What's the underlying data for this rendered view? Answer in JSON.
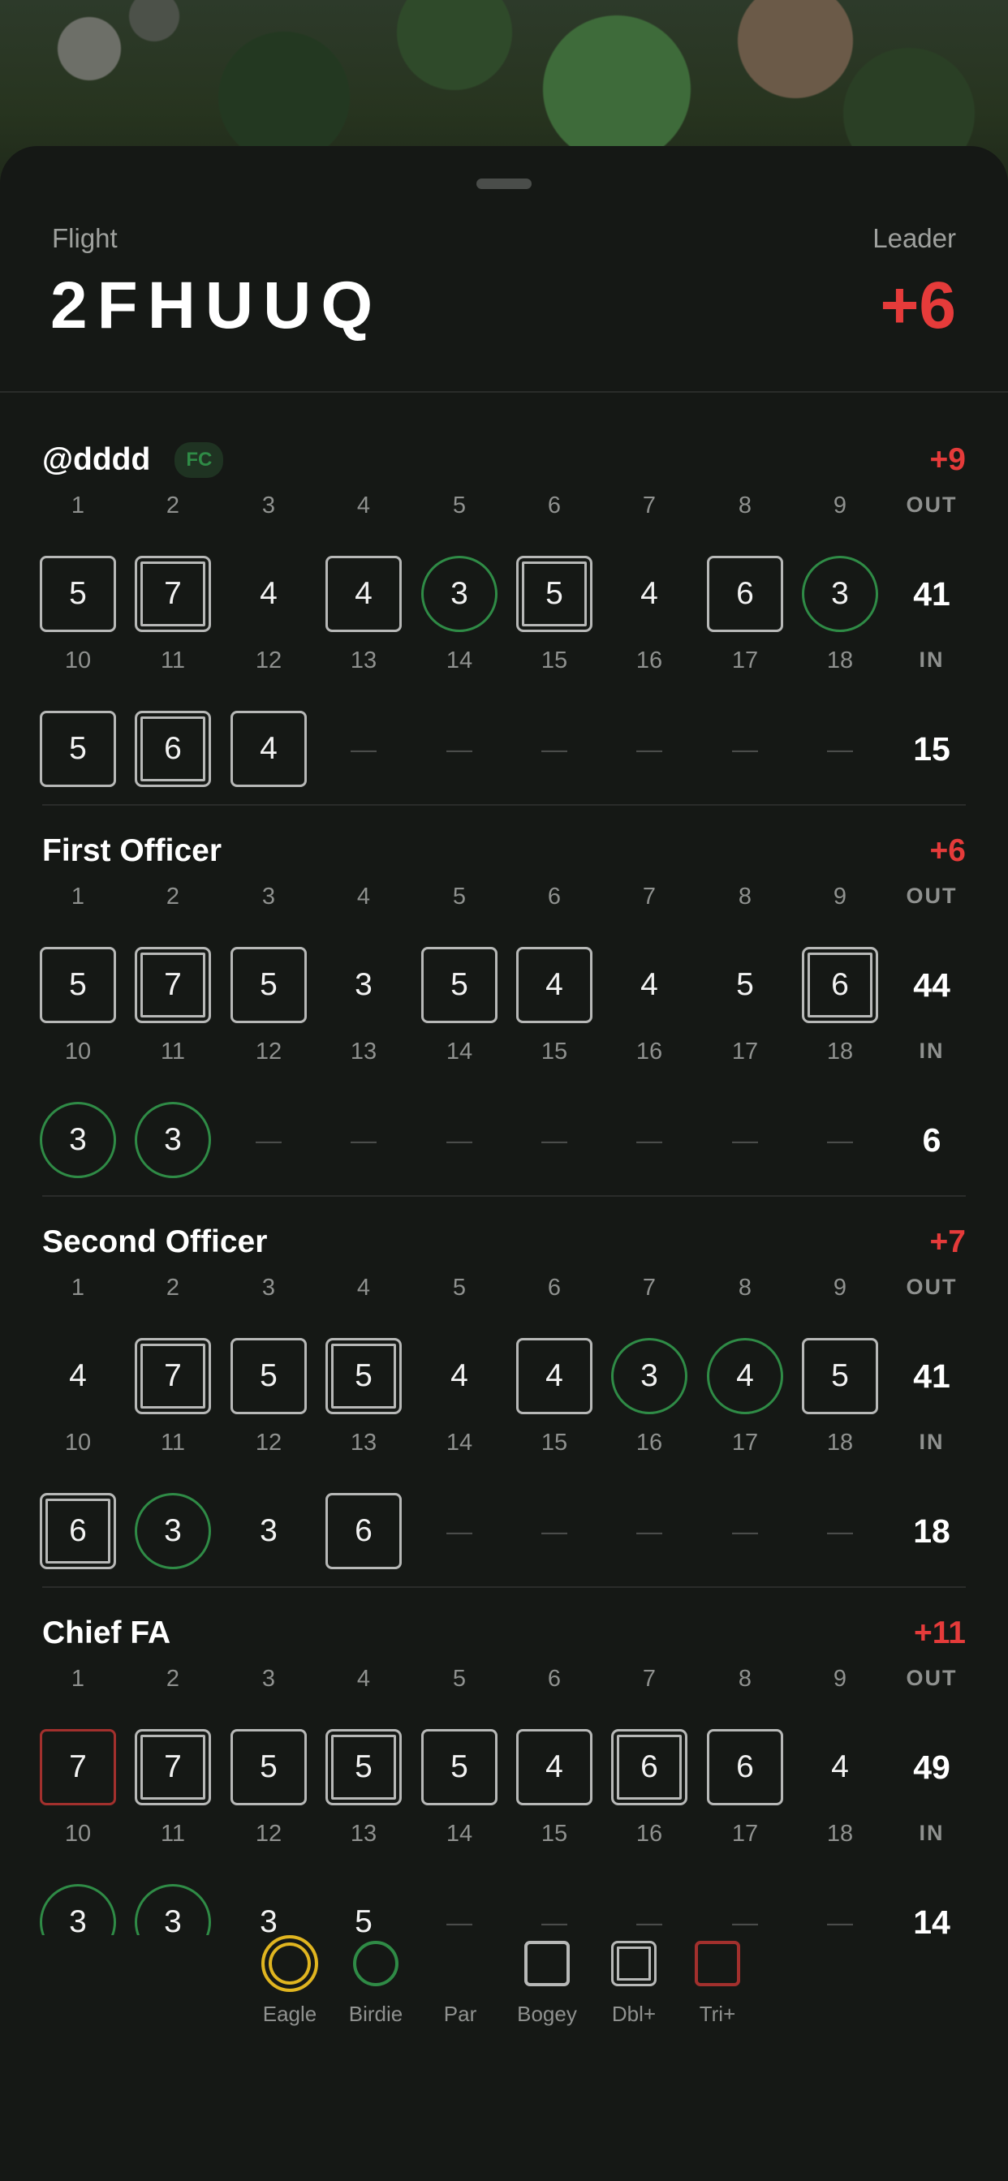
{
  "header": {
    "flight_label": "Flight",
    "flight_code": "2FHUUQ",
    "leader_label": "Leader",
    "leader_score": "+6"
  },
  "holes_front": [
    "1",
    "2",
    "3",
    "4",
    "5",
    "6",
    "7",
    "8",
    "9"
  ],
  "holes_back": [
    "10",
    "11",
    "12",
    "13",
    "14",
    "15",
    "16",
    "17",
    "18"
  ],
  "out_label": "OUT",
  "in_label": "IN",
  "dash": "—",
  "players": [
    {
      "name": "@dddd",
      "badge": "FC",
      "total": "+9",
      "front": [
        {
          "v": "5",
          "t": "bogey"
        },
        {
          "v": "7",
          "t": "dbl"
        },
        {
          "v": "4",
          "t": "par"
        },
        {
          "v": "4",
          "t": "bogey"
        },
        {
          "v": "3",
          "t": "birdie"
        },
        {
          "v": "5",
          "t": "dbl"
        },
        {
          "v": "4",
          "t": "par"
        },
        {
          "v": "6",
          "t": "bogey"
        },
        {
          "v": "3",
          "t": "birdie"
        }
      ],
      "out": "41",
      "back": [
        {
          "v": "5",
          "t": "bogey"
        },
        {
          "v": "6",
          "t": "dbl"
        },
        {
          "v": "4",
          "t": "bogey"
        },
        {
          "v": "—",
          "t": "dash"
        },
        {
          "v": "—",
          "t": "dash"
        },
        {
          "v": "—",
          "t": "dash"
        },
        {
          "v": "—",
          "t": "dash"
        },
        {
          "v": "—",
          "t": "dash"
        },
        {
          "v": "—",
          "t": "dash"
        }
      ],
      "in": "15"
    },
    {
      "name": "First Officer",
      "badge": "",
      "total": "+6",
      "front": [
        {
          "v": "5",
          "t": "bogey"
        },
        {
          "v": "7",
          "t": "dbl"
        },
        {
          "v": "5",
          "t": "bogey"
        },
        {
          "v": "3",
          "t": "par"
        },
        {
          "v": "5",
          "t": "bogey"
        },
        {
          "v": "4",
          "t": "bogey"
        },
        {
          "v": "4",
          "t": "par"
        },
        {
          "v": "5",
          "t": "par"
        },
        {
          "v": "6",
          "t": "dbl"
        }
      ],
      "out": "44",
      "back": [
        {
          "v": "3",
          "t": "birdie"
        },
        {
          "v": "3",
          "t": "birdie"
        },
        {
          "v": "—",
          "t": "dash"
        },
        {
          "v": "—",
          "t": "dash"
        },
        {
          "v": "—",
          "t": "dash"
        },
        {
          "v": "—",
          "t": "dash"
        },
        {
          "v": "—",
          "t": "dash"
        },
        {
          "v": "—",
          "t": "dash"
        },
        {
          "v": "—",
          "t": "dash"
        }
      ],
      "in": "6"
    },
    {
      "name": "Second Officer",
      "badge": "",
      "total": "+7",
      "front": [
        {
          "v": "4",
          "t": "par"
        },
        {
          "v": "7",
          "t": "dbl"
        },
        {
          "v": "5",
          "t": "bogey"
        },
        {
          "v": "5",
          "t": "dbl"
        },
        {
          "v": "4",
          "t": "par"
        },
        {
          "v": "4",
          "t": "bogey"
        },
        {
          "v": "3",
          "t": "birdie"
        },
        {
          "v": "4",
          "t": "birdie"
        },
        {
          "v": "5",
          "t": "bogey"
        }
      ],
      "out": "41",
      "back": [
        {
          "v": "6",
          "t": "dbl"
        },
        {
          "v": "3",
          "t": "birdie"
        },
        {
          "v": "3",
          "t": "par"
        },
        {
          "v": "6",
          "t": "bogey"
        },
        {
          "v": "—",
          "t": "dash"
        },
        {
          "v": "—",
          "t": "dash"
        },
        {
          "v": "—",
          "t": "dash"
        },
        {
          "v": "—",
          "t": "dash"
        },
        {
          "v": "—",
          "t": "dash"
        }
      ],
      "in": "18"
    },
    {
      "name": "Chief FA",
      "badge": "",
      "total": "+11",
      "front": [
        {
          "v": "7",
          "t": "tri"
        },
        {
          "v": "7",
          "t": "dbl"
        },
        {
          "v": "5",
          "t": "bogey"
        },
        {
          "v": "5",
          "t": "dbl"
        },
        {
          "v": "5",
          "t": "bogey"
        },
        {
          "v": "4",
          "t": "bogey"
        },
        {
          "v": "6",
          "t": "dbl"
        },
        {
          "v": "6",
          "t": "bogey"
        },
        {
          "v": "4",
          "t": "par"
        }
      ],
      "out": "49",
      "back": [
        {
          "v": "3",
          "t": "birdie"
        },
        {
          "v": "3",
          "t": "birdie"
        },
        {
          "v": "3",
          "t": "par"
        },
        {
          "v": "5",
          "t": "par"
        },
        {
          "v": "—",
          "t": "dash"
        },
        {
          "v": "—",
          "t": "dash"
        },
        {
          "v": "—",
          "t": "dash"
        },
        {
          "v": "—",
          "t": "dash"
        },
        {
          "v": "—",
          "t": "dash"
        }
      ],
      "in": "14"
    }
  ],
  "legend": [
    {
      "label": "Eagle",
      "icon": "eagle-icon"
    },
    {
      "label": "Birdie",
      "icon": "birdie-icon"
    },
    {
      "label": "Par",
      "icon": "par-icon"
    },
    {
      "label": "Bogey",
      "icon": "bogey-icon"
    },
    {
      "label": "Dbl+",
      "icon": "double-bogey-icon"
    },
    {
      "label": "Tri+",
      "icon": "triple-bogey-icon"
    }
  ],
  "colors": {
    "over_par": "#e53b3a",
    "birdie": "#2f8b46",
    "eagle": "#e0b520",
    "bogey": "#b7b8b7",
    "triple": "#a2302d"
  }
}
